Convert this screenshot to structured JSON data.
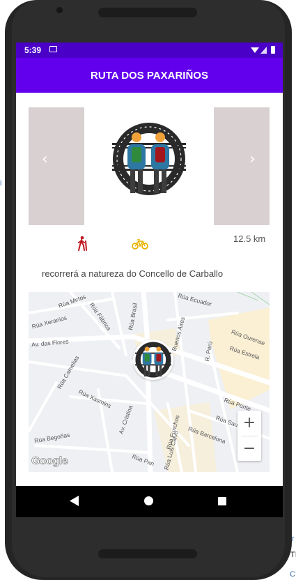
{
  "status_bar": {
    "time": "5:39"
  },
  "app_bar": {
    "title": "RUTA DOS PAXARIÑOS"
  },
  "route": {
    "distance": "12.5 km",
    "description": "recorrerá a natureza do Concello de Carballo",
    "activities": [
      "walk-icon",
      "bike-icon"
    ]
  },
  "carousel": {
    "prev_icon": "chevron-left-icon",
    "next_icon": "chevron-right-icon"
  },
  "map": {
    "streets": [
      "Rúa Mirtos",
      "Rúa Ecuador",
      "Rúa Xeranios",
      "Rúa Fábrica",
      "Rúa Brasil",
      "Buenos Aires",
      "Rúa Ourense",
      "Av. das Flores",
      "R. Perú",
      "Rúa Estrela",
      "Rúa Camelias",
      "Rúa Xasmins",
      "Av. Cristina",
      "Rúa Ponte",
      "Rúa Funchos",
      "Rúa Saude",
      "Rúa Barcelona",
      "Rúa Luis Calvo",
      "Rúa Begoñas",
      "Rúa Pan"
    ],
    "zoom_in": "+",
    "zoom_out": "−",
    "attribution": "Google"
  },
  "background_fragments": {
    "left": "i",
    "right_1": "r",
    "right_2": "TI",
    "right_3": "C"
  },
  "colors": {
    "status_bar": "#4a00c7",
    "app_bar": "#6200ee",
    "walk_icon": "#c0171f",
    "bike_icon": "#e8b400"
  }
}
